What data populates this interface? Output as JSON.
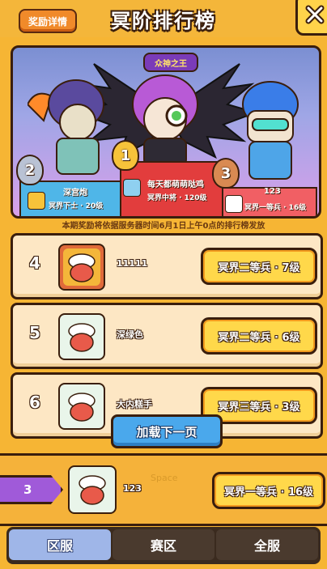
{
  "header": {
    "title": "冥阶排行榜",
    "reward_button": "奖励详情"
  },
  "podium": {
    "crown_label": "众神之王",
    "first": {
      "rank": "1",
      "name": "每天都萌萌哒鸡",
      "title": "冥界中将 · 120级"
    },
    "second": {
      "rank": "2",
      "name": "深宫炮",
      "title": "冥界下士 · 20级"
    },
    "third": {
      "rank": "3",
      "name": "123",
      "title": "冥界一等兵 · 16级"
    }
  },
  "notice": "本期奖励将依据服务器时间6月1日上午0点的排行榜发放",
  "rows": [
    {
      "rank": "4",
      "name": "11111",
      "title": "冥界二等兵 · 7级"
    },
    {
      "rank": "5",
      "name": "深绿色",
      "title": "冥界二等兵 · 6级"
    },
    {
      "rank": "6",
      "name": "大内糕手",
      "title": "冥界三等兵 · 3级"
    }
  ],
  "load_more": "加载下一页",
  "self": {
    "rank": "3",
    "name": "123",
    "title": "冥界一等兵 · 16级",
    "watermark": "Space"
  },
  "tabs": [
    {
      "label": "区服",
      "active": true
    },
    {
      "label": "赛区",
      "active": false
    },
    {
      "label": "全服",
      "active": false
    }
  ]
}
